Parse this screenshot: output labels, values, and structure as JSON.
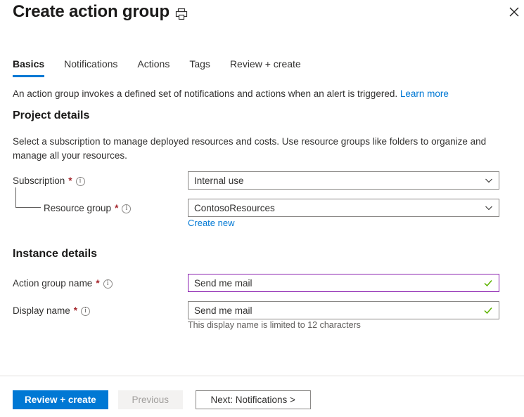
{
  "header": {
    "title": "Create action group",
    "print_icon": "printer-icon",
    "close_icon": "close-icon"
  },
  "tabs": [
    {
      "label": "Basics",
      "active": true
    },
    {
      "label": "Notifications",
      "active": false
    },
    {
      "label": "Actions",
      "active": false
    },
    {
      "label": "Tags",
      "active": false
    },
    {
      "label": "Review + create",
      "active": false
    }
  ],
  "intro": {
    "text": "An action group invokes a defined set of notifications and actions when an alert is triggered.",
    "link_label": "Learn more"
  },
  "project_details": {
    "title": "Project details",
    "description": "Select a subscription to manage deployed resources and costs. Use resource groups like folders to organize and manage all your resources.",
    "subscription": {
      "label": "Subscription",
      "required": "*",
      "value": "Internal use",
      "info_icon": "info-icon",
      "chevron_icon": "chevron-down-icon"
    },
    "resource_group": {
      "label": "Resource group",
      "required": "*",
      "value": "ContosoResources",
      "info_icon": "info-icon",
      "chevron_icon": "chevron-down-icon",
      "create_new_label": "Create new"
    }
  },
  "instance_details": {
    "title": "Instance details",
    "action_group_name": {
      "label": "Action group name",
      "required": "*",
      "value": "Send me mail",
      "placeholder": "",
      "info_icon": "info-icon",
      "validation_icon": "checkmark-icon",
      "focused": true
    },
    "display_name": {
      "label": "Display name",
      "required": "*",
      "value": "Send me mail",
      "placeholder": "",
      "info_icon": "info-icon",
      "validation_icon": "checkmark-icon",
      "helper_text": "This display name is limited to 12 characters"
    }
  },
  "footer": {
    "review_create_label": "Review + create",
    "previous_label": "Previous",
    "next_label": "Next: Notifications >"
  },
  "colors": {
    "accent": "#0078d4",
    "required": "#a4262c",
    "focus_border": "#8b21b0",
    "valid_check": "#5db300",
    "border": "#8a8886",
    "text": "#323130",
    "muted_text": "#605e5c"
  }
}
